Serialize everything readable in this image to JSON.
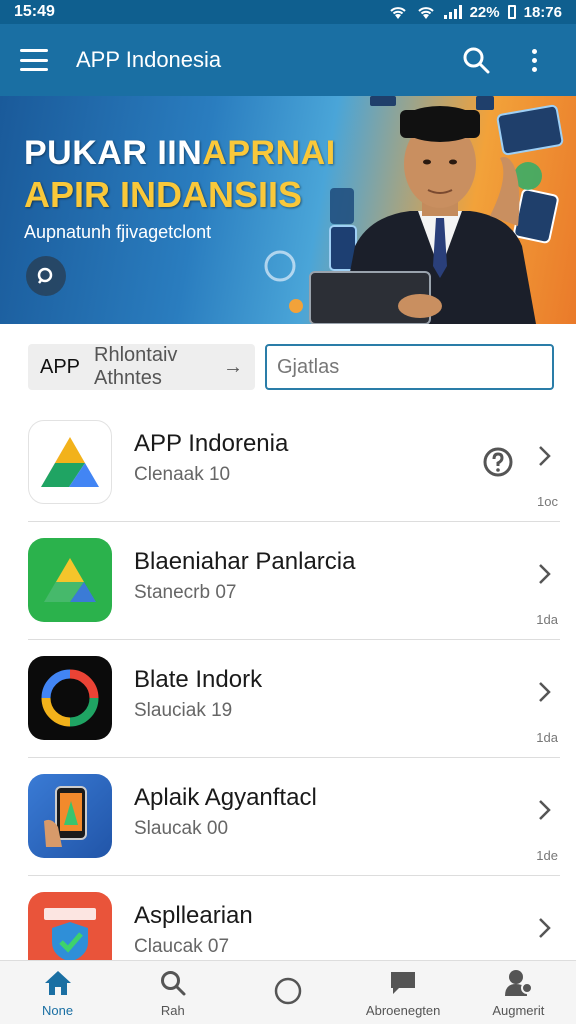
{
  "status_bar": {
    "time": "15:49",
    "battery": "22%",
    "clock": "18:76"
  },
  "app_bar": {
    "title": "APP Indonesia"
  },
  "banner": {
    "line1_prefix": "PUKAR IIN",
    "line1_highlight": "APRNAI",
    "line2": "APIR INDANSIIS",
    "subtitle": "Aupnatunh fjivagetclont",
    "accent_color": "#f9c83a"
  },
  "search": {
    "chip_label": "APP",
    "chip_text": "Rhlontaiv Athntes",
    "chip_arrow": "→",
    "placeholder": "Gjatlas"
  },
  "apps": [
    {
      "name": "APP Indorenia",
      "subtitle": "Clenaak 10",
      "meta": "1oc",
      "icon": "drive-triangle-icon",
      "has_info": true
    },
    {
      "name": "Blaeniahar Panlarcia",
      "subtitle": "Stanecrb 07",
      "meta": "1da",
      "icon": "green-triangle-icon",
      "has_info": false
    },
    {
      "name": "Blate Indork",
      "subtitle": "Slauciak 19",
      "meta": "1da",
      "icon": "color-ring-icon",
      "has_info": false
    },
    {
      "name": "Aplaik Agyanftacl",
      "subtitle": "Slaucak 00",
      "meta": "1de",
      "icon": "phone-hand-icon",
      "has_info": false
    },
    {
      "name": "Aspllearian",
      "subtitle": "Claucak 07",
      "meta": "",
      "icon": "shield-check-icon",
      "has_info": false
    }
  ],
  "bottom_nav": [
    {
      "label": "None",
      "icon": "home-icon",
      "active": true
    },
    {
      "label": "Rah",
      "icon": "search-icon",
      "active": false
    },
    {
      "label": "",
      "icon": "circle-icon",
      "active": false
    },
    {
      "label": "Abroenegten",
      "icon": "chat-icon",
      "active": false
    },
    {
      "label": "Augmerit",
      "icon": "profile-icon",
      "active": false
    }
  ],
  "colors": {
    "primary": "#1a6fa3",
    "status": "#0f5f8f",
    "border": "#2a7da8"
  }
}
